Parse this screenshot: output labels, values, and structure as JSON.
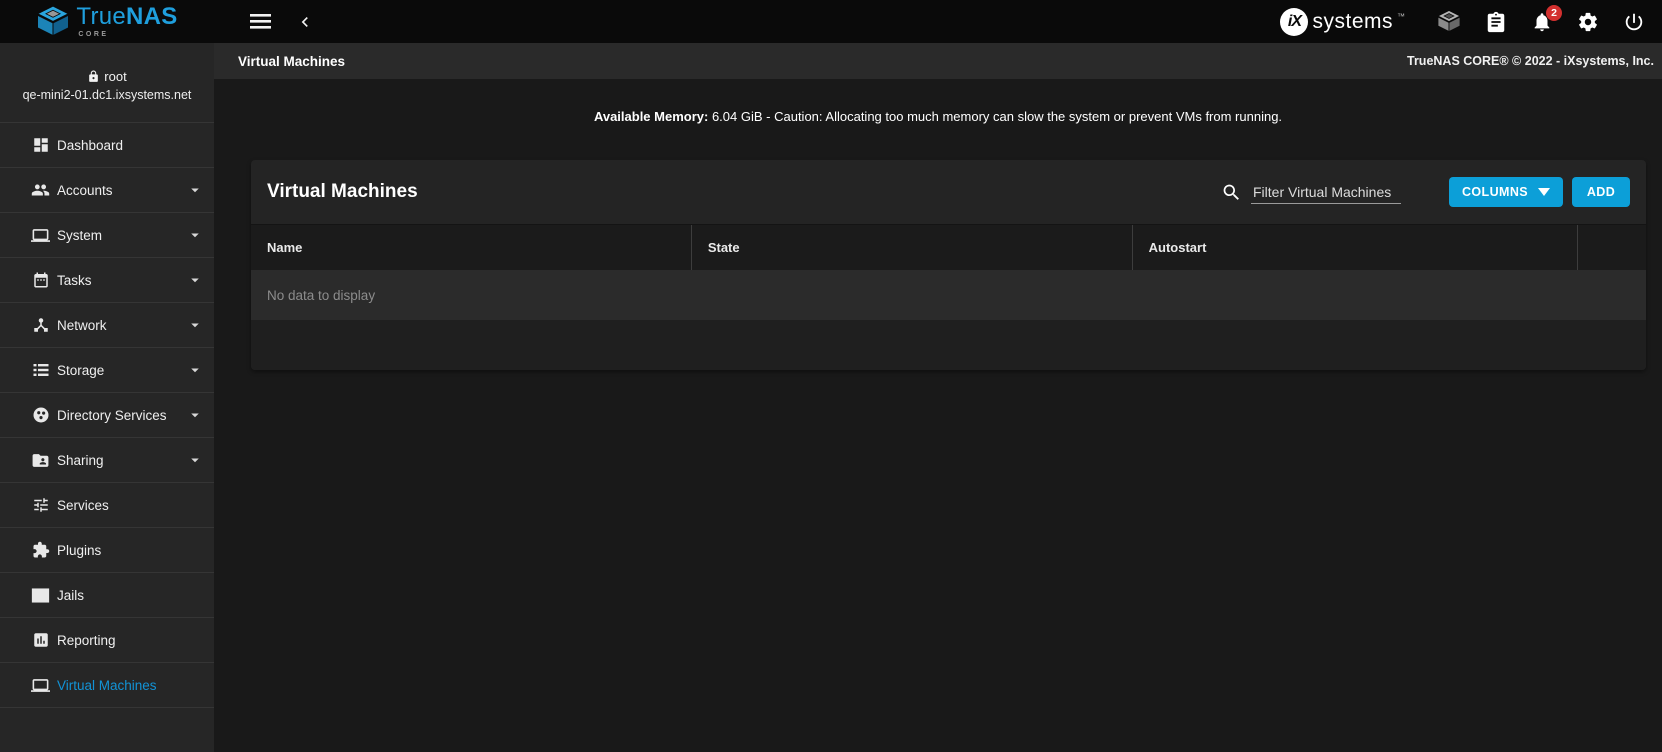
{
  "app": {
    "brand_primary": "True",
    "brand_secondary": "NAS",
    "brand_edition": "CORE",
    "ix_mark": "iX",
    "ix_text": "systems",
    "ix_tm": "™",
    "notifications_count": "2"
  },
  "header": {
    "breadcrumb": "Virtual Machines",
    "copyright": "TrueNAS CORE® © 2022 - iXsystems, Inc."
  },
  "sidebar": {
    "user": "root",
    "hostname": "qe-mini2-01.dc1.ixsystems.net",
    "items": [
      {
        "label": "Dashboard",
        "icon": "dashboard-icon",
        "expandable": false,
        "active": false
      },
      {
        "label": "Accounts",
        "icon": "accounts-people-icon",
        "expandable": true,
        "active": false
      },
      {
        "label": "System",
        "icon": "system-laptop-icon",
        "expandable": true,
        "active": false
      },
      {
        "label": "Tasks",
        "icon": "tasks-calendar-icon",
        "expandable": true,
        "active": false
      },
      {
        "label": "Network",
        "icon": "network-hub-icon",
        "expandable": true,
        "active": false
      },
      {
        "label": "Storage",
        "icon": "storage-disks-icon",
        "expandable": true,
        "active": false
      },
      {
        "label": "Directory Services",
        "icon": "directory-services-icon",
        "expandable": true,
        "active": false
      },
      {
        "label": "Sharing",
        "icon": "folder-shared-icon",
        "expandable": true,
        "active": false
      },
      {
        "label": "Services",
        "icon": "services-tune-icon",
        "expandable": false,
        "active": false
      },
      {
        "label": "Plugins",
        "icon": "plugins-puzzle-icon",
        "expandable": false,
        "active": false
      },
      {
        "label": "Jails",
        "icon": "jails-icon",
        "expandable": false,
        "active": false
      },
      {
        "label": "Reporting",
        "icon": "reporting-chart-icon",
        "expandable": false,
        "active": false
      },
      {
        "label": "Virtual Machines",
        "icon": "vm-laptop-icon",
        "expandable": false,
        "active": true
      }
    ]
  },
  "notice": {
    "label": "Available Memory:",
    "text": " 6.04 GiB - Caution: Allocating too much memory can slow the system or prevent VMs from running."
  },
  "card": {
    "title": "Virtual Machines",
    "filter_placeholder": "Filter Virtual Machines",
    "columns_button": "COLUMNS",
    "add_button": "ADD",
    "table": {
      "headers": [
        "Name",
        "State",
        "Autostart"
      ],
      "empty_message": "No data to display"
    }
  },
  "colors": {
    "accent": "#0c9fd8",
    "active_link": "#1293d6",
    "badge": "#d3302f"
  }
}
